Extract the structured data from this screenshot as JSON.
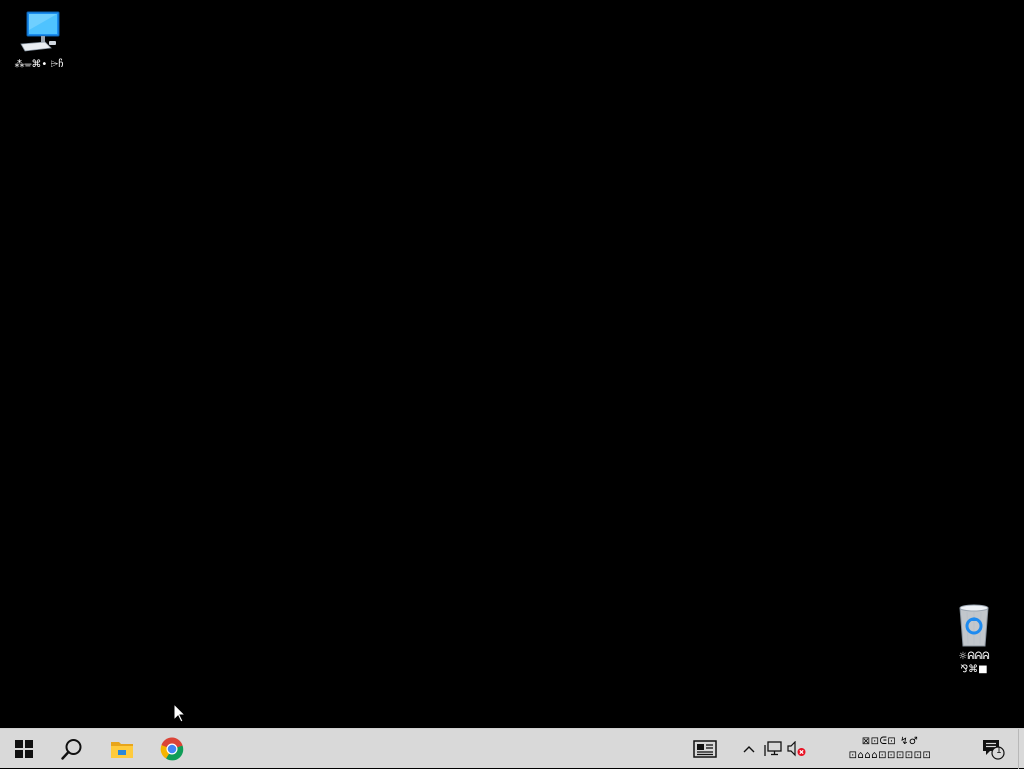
{
  "desktop": {
    "icons": [
      {
        "name": "this-pc",
        "label": "⁂ᚚ⌘• ⌲ჩ"
      },
      {
        "name": "recycle-bin",
        "label": "☼ᕱᕱᕱ\n⅋⌘■"
      }
    ]
  },
  "taskbar": {
    "start_icon": "windows-logo-icon",
    "search_icon": "search-icon",
    "pinned": [
      "file-explorer-icon",
      "chrome-icon"
    ],
    "tray": {
      "news_icon": "news-widget-icon",
      "chevron_icon": "chevron-up-icon",
      "network_icon": "network-icon",
      "volume_icon": "volume-muted-icon",
      "time": "⊠⊡ᕮ⊡ ↯♂",
      "date": "⊡⌂⌂⌂⊡⊡⊡⊡⊡⊡",
      "notification_count": "1"
    }
  },
  "colors": {
    "desktop_bg": "#000000",
    "taskbar_bg": "#d9d9d9",
    "accent": "#1e90ff"
  }
}
